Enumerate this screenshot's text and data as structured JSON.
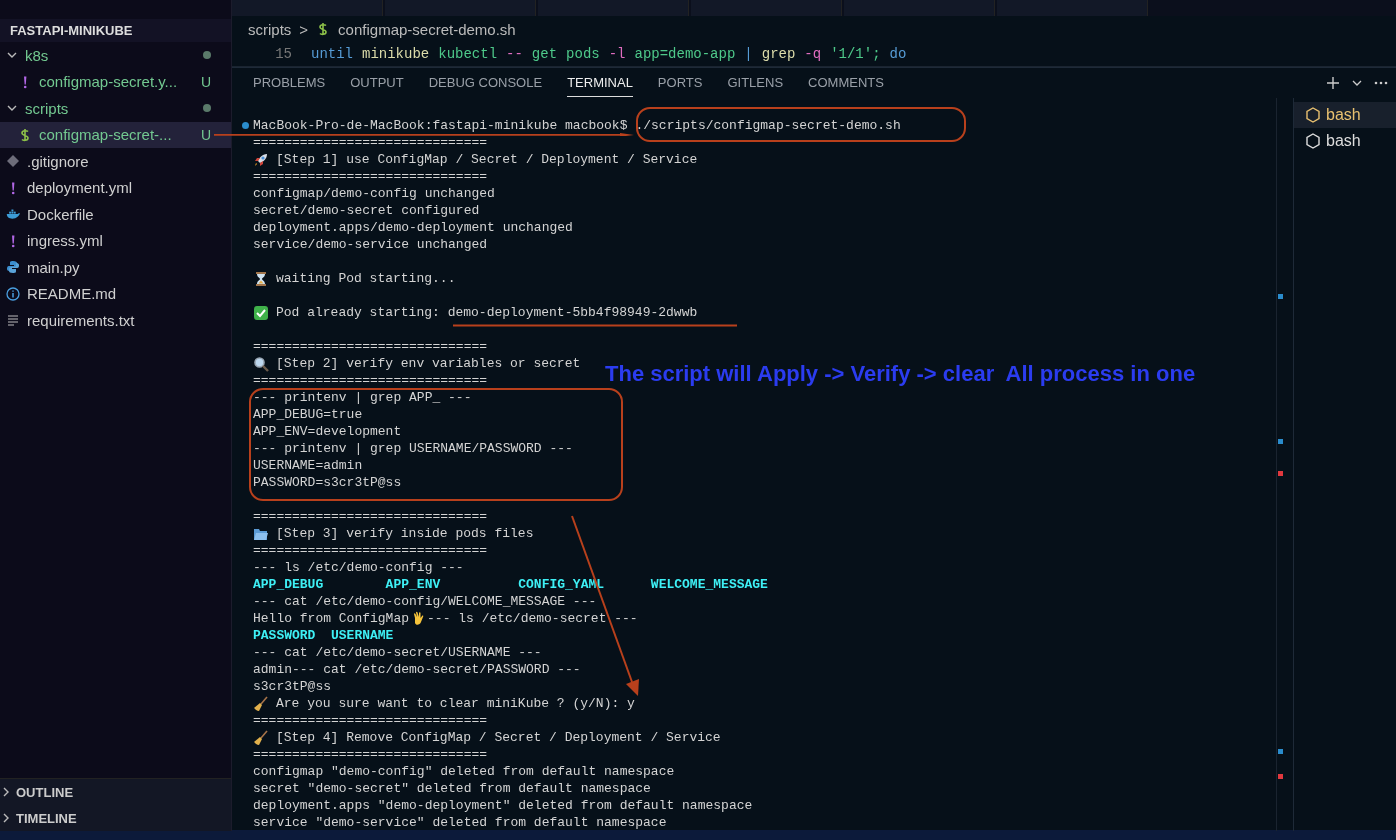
{
  "sidebar": {
    "project": "FASTAPI-MINIKUBE",
    "tree": [
      {
        "label": "k8s",
        "kind": "folder",
        "expanded": true,
        "dot": true,
        "selected": false,
        "children": [
          {
            "label": "configmap-secret.y...",
            "kind": "yaml",
            "status": "U",
            "selected": false
          }
        ]
      },
      {
        "label": "scripts",
        "kind": "folder",
        "expanded": true,
        "dot": true,
        "selected": false,
        "children": [
          {
            "label": "configmap-secret-...",
            "kind": "shell",
            "status": "U",
            "selected": true
          }
        ]
      },
      {
        "label": ".gitignore",
        "kind": "git",
        "selected": false
      },
      {
        "label": "deployment.yml",
        "kind": "yaml",
        "selected": false
      },
      {
        "label": "Dockerfile",
        "kind": "docker",
        "selected": false
      },
      {
        "label": "ingress.yml",
        "kind": "yaml",
        "selected": false
      },
      {
        "label": "main.py",
        "kind": "python",
        "selected": false
      },
      {
        "label": "README.md",
        "kind": "info",
        "selected": false
      },
      {
        "label": "requirements.txt",
        "kind": "text",
        "selected": false
      }
    ],
    "sections": [
      {
        "label": "OUTLINE",
        "expanded": false
      },
      {
        "label": "TIMELINE",
        "expanded": false
      }
    ]
  },
  "breadcrumb": {
    "folder": "scripts",
    "separator": ">",
    "file": "configmap-secret-demo.sh"
  },
  "code_line": {
    "number": "15",
    "tokens": [
      {
        "text": "until",
        "color": "#569cd6"
      },
      {
        "text": "minikube",
        "color": "#dcdcaa"
      },
      {
        "text": "kubectl",
        "color": "#4ec98a"
      },
      {
        "text": "--",
        "color": "#e06cc0"
      },
      {
        "text": "get",
        "color": "#4ec98a"
      },
      {
        "text": "pods",
        "color": "#4ec98a"
      },
      {
        "text": "-l",
        "color": "#e06cc0"
      },
      {
        "text": "app=demo-app",
        "color": "#4ec98a"
      },
      {
        "text": "|",
        "color": "#569cd6"
      },
      {
        "text": "grep",
        "color": "#dcdcaa"
      },
      {
        "text": "-q",
        "color": "#e06cc0"
      },
      {
        "text": "'1/1';",
        "color": "#4ec98a"
      },
      {
        "text": "do",
        "color": "#569cd6"
      }
    ]
  },
  "panel_tabs": [
    {
      "label": "PROBLEMS",
      "selected": false
    },
    {
      "label": "OUTPUT",
      "selected": false
    },
    {
      "label": "DEBUG CONSOLE",
      "selected": false
    },
    {
      "label": "TERMINAL",
      "selected": true
    },
    {
      "label": "PORTS",
      "selected": false
    },
    {
      "label": "GITLENS",
      "selected": false
    },
    {
      "label": "COMMENTS",
      "selected": false
    }
  ],
  "terminals": [
    {
      "label": "bash",
      "selected": true
    },
    {
      "label": "bash",
      "selected": false
    }
  ],
  "terminal": {
    "prompt": "MacBook-Pro-de-MacBook:fastapi-minikube macbook$",
    "command": "./scripts/configmap-secret-demo.sh",
    "lines": [
      {
        "kind": "plain",
        "parts": [
          {
            "text": "=============================="
          }
        ]
      },
      {
        "kind": "plain",
        "parts": [
          {
            "kind": "emoji"
          },
          {
            "text": "[Step 1] use ConfigMap / Secret / Deployment / Service"
          }
        ]
      },
      {
        "kind": "plain",
        "parts": [
          {
            "text": "=============================="
          }
        ]
      },
      {
        "kind": "plain",
        "parts": [
          {
            "text": "configmap/demo-config unchanged"
          }
        ]
      },
      {
        "kind": "plain",
        "parts": [
          {
            "text": "secret/demo-secret configured"
          }
        ]
      },
      {
        "kind": "plain",
        "parts": [
          {
            "text": "deployment.apps/demo-deployment unchanged"
          }
        ]
      },
      {
        "kind": "plain",
        "parts": [
          {
            "text": "service/demo-service unchanged"
          }
        ]
      },
      {
        "kind": "blank"
      },
      {
        "kind": "plain",
        "parts": [
          {
            "kind": "emoji"
          },
          {
            "text": "waiting Pod starting..."
          }
        ]
      },
      {
        "kind": "blank"
      },
      {
        "kind": "plain",
        "parts": [
          {
            "kind": "emoji"
          },
          {
            "text": "Pod already starting: demo-deployment-5bb4f98949-2dwwb"
          }
        ]
      },
      {
        "kind": "blank"
      },
      {
        "kind": "plain",
        "parts": [
          {
            "text": "=============================="
          }
        ]
      },
      {
        "kind": "plain",
        "parts": [
          {
            "kind": "emoji"
          },
          {
            "text": "[Step 2] verify env variables or secret"
          }
        ]
      },
      {
        "kind": "plain",
        "parts": [
          {
            "text": "=============================="
          }
        ]
      },
      {
        "kind": "plain",
        "parts": [
          {
            "text": "--- printenv | grep APP_ ---"
          }
        ]
      },
      {
        "kind": "plain",
        "parts": [
          {
            "text": "APP_DEBUG=true"
          }
        ]
      },
      {
        "kind": "plain",
        "parts": [
          {
            "text": "APP_ENV=development"
          }
        ]
      },
      {
        "kind": "plain",
        "parts": [
          {
            "text": "--- printenv | grep USERNAME/PASSWORD ---"
          }
        ]
      },
      {
        "kind": "plain",
        "parts": [
          {
            "text": "USERNAME=admin"
          }
        ]
      },
      {
        "kind": "plain",
        "parts": [
          {
            "text": "PASSWORD=s3cr3tP@ss"
          }
        ]
      },
      {
        "kind": "blank"
      },
      {
        "kind": "plain",
        "parts": [
          {
            "text": "=============================="
          }
        ]
      },
      {
        "kind": "plain",
        "parts": [
          {
            "kind": "emoji"
          },
          {
            "text": "[Step 3] verify inside pods files"
          }
        ]
      },
      {
        "kind": "plain",
        "parts": [
          {
            "text": "=============================="
          }
        ]
      },
      {
        "kind": "plain",
        "parts": [
          {
            "text": "--- ls /etc/demo-config ---"
          }
        ]
      },
      {
        "kind": "listing",
        "parts": [
          {
            "text": "APP_DEBUG        APP_ENV          CONFIG_YAML      WELCOME_MESSAGE"
          }
        ]
      },
      {
        "kind": "plain",
        "parts": [
          {
            "text": "--- cat /etc/demo-config/WELCOME_MESSAGE ---"
          }
        ]
      },
      {
        "kind": "plain",
        "parts": [
          {
            "text": "Hello from ConfigMap"
          },
          {
            "kind": "emoji"
          },
          {
            "text": "--- ls /etc/demo-secret ---"
          }
        ]
      },
      {
        "kind": "listing",
        "parts": [
          {
            "text": "PASSWORD  USERNAME"
          }
        ]
      },
      {
        "kind": "plain",
        "parts": [
          {
            "text": "--- cat /etc/demo-secret/USERNAME ---"
          }
        ]
      },
      {
        "kind": "plain",
        "parts": [
          {
            "text": "admin--- cat /etc/demo-secret/PASSWORD ---"
          }
        ]
      },
      {
        "kind": "plain",
        "parts": [
          {
            "text": "s3cr3tP@ss"
          }
        ]
      },
      {
        "kind": "plain",
        "parts": [
          {
            "kind": "emoji"
          },
          {
            "text": "Are you sure want to clear miniKube ? (y/N): y"
          }
        ]
      },
      {
        "kind": "plain",
        "parts": [
          {
            "text": "=============================="
          }
        ]
      },
      {
        "kind": "plain",
        "parts": [
          {
            "kind": "emoji"
          },
          {
            "text": "[Step 4] Remove ConfigMap / Secret / Deployment / Service"
          }
        ]
      },
      {
        "kind": "plain",
        "parts": [
          {
            "text": "=============================="
          }
        ]
      },
      {
        "kind": "plain",
        "parts": [
          {
            "text": "configmap \"demo-config\" deleted from default namespace"
          }
        ]
      },
      {
        "kind": "plain",
        "parts": [
          {
            "text": "secret \"demo-secret\" deleted from default namespace"
          }
        ]
      },
      {
        "kind": "plain",
        "parts": [
          {
            "text": "deployment.apps \"demo-deployment\" deleted from default namespace"
          }
        ]
      },
      {
        "kind": "plain",
        "parts": [
          {
            "text": "service \"demo-service\" deleted from default namespace"
          }
        ]
      }
    ]
  },
  "annotation": {
    "text": "The script will Apply -> Verify -> clear  All process in one"
  }
}
